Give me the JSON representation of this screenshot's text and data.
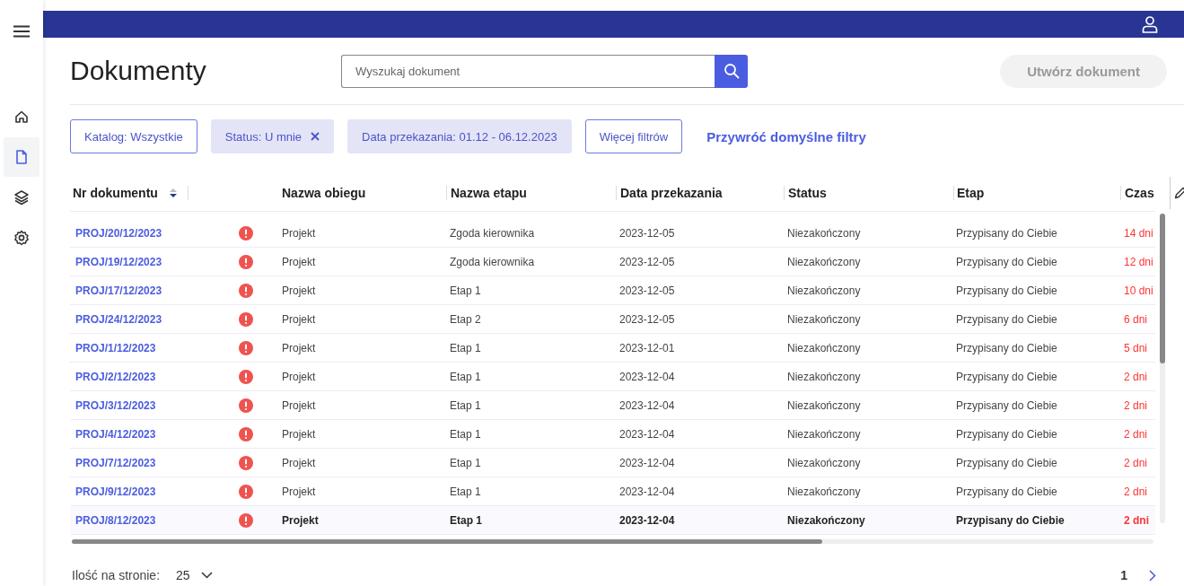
{
  "sidebar": {
    "items": [
      {
        "kind": "home",
        "selected": false
      },
      {
        "kind": "document",
        "selected": true
      },
      {
        "kind": "layers",
        "selected": false
      },
      {
        "kind": "settings",
        "selected": false
      }
    ]
  },
  "header": {
    "title": "Dokumenty",
    "search": {
      "placeholder": "Wyszukaj dokument"
    },
    "create_button": {
      "label": "Utwórz dokument",
      "disabled": true
    }
  },
  "filters": [
    {
      "kind": "outline",
      "label": "Katalog: Wszystkie",
      "removable": false
    },
    {
      "kind": "chip",
      "label": "Status: U mnie",
      "removable": true
    },
    {
      "kind": "chip",
      "label": "Data przekazania: 01.12 - 06.12.2023",
      "removable": false
    },
    {
      "kind": "outline",
      "label": "Więcej filtrów",
      "removable": false
    }
  ],
  "reset_link": "Przywróć domyślne filtry",
  "table": {
    "columns": [
      {
        "label": "Nr dokumentu",
        "sortable": true
      },
      {
        "label": "Nazwa obiegu"
      },
      {
        "label": "Nazwa etapu"
      },
      {
        "label": "Data przekazania"
      },
      {
        "label": "Status"
      },
      {
        "label": "Etap"
      },
      {
        "label": "Czas"
      }
    ],
    "rows": [
      {
        "number": "PROJ/20/12/2023",
        "alert": true,
        "workflow": "Projekt",
        "stage": "Zgoda kierownika",
        "date": "2023-12-05",
        "status": "Niezakończony",
        "step": "Przypisany do Ciebie",
        "time": "14 dni",
        "selected": false
      },
      {
        "number": "PROJ/19/12/2023",
        "alert": true,
        "workflow": "Projekt",
        "stage": "Zgoda kierownika",
        "date": "2023-12-05",
        "status": "Niezakończony",
        "step": "Przypisany do Ciebie",
        "time": "12 dni",
        "selected": false
      },
      {
        "number": "PROJ/17/12/2023",
        "alert": true,
        "workflow": "Projekt",
        "stage": "Etap 1",
        "date": "2023-12-05",
        "status": "Niezakończony",
        "step": "Przypisany do Ciebie",
        "time": "10 dni",
        "selected": false
      },
      {
        "number": "PROJ/24/12/2023",
        "alert": true,
        "workflow": "Projekt",
        "stage": "Etap 2",
        "date": "2023-12-05",
        "status": "Niezakończony",
        "step": "Przypisany do Ciebie",
        "time": "6 dni",
        "selected": false
      },
      {
        "number": "PROJ/1/12/2023",
        "alert": true,
        "workflow": "Projekt",
        "stage": "Etap 1",
        "date": "2023-12-01",
        "status": "Niezakończony",
        "step": "Przypisany do Ciebie",
        "time": "5 dni",
        "selected": false
      },
      {
        "number": "PROJ/2/12/2023",
        "alert": true,
        "workflow": "Projekt",
        "stage": "Etap 1",
        "date": "2023-12-04",
        "status": "Niezakończony",
        "step": "Przypisany do Ciebie",
        "time": "2 dni",
        "selected": false
      },
      {
        "number": "PROJ/3/12/2023",
        "alert": true,
        "workflow": "Projekt",
        "stage": "Etap 1",
        "date": "2023-12-04",
        "status": "Niezakończony",
        "step": "Przypisany do Ciebie",
        "time": "2 dni",
        "selected": false
      },
      {
        "number": "PROJ/4/12/2023",
        "alert": true,
        "workflow": "Projekt",
        "stage": "Etap 1",
        "date": "2023-12-04",
        "status": "Niezakończony",
        "step": "Przypisany do Ciebie",
        "time": "2 dni",
        "selected": false
      },
      {
        "number": "PROJ/7/12/2023",
        "alert": true,
        "workflow": "Projekt",
        "stage": "Etap 1",
        "date": "2023-12-04",
        "status": "Niezakończony",
        "step": "Przypisany do Ciebie",
        "time": "2 dni",
        "selected": false
      },
      {
        "number": "PROJ/9/12/2023",
        "alert": true,
        "workflow": "Projekt",
        "stage": "Etap 1",
        "date": "2023-12-04",
        "status": "Niezakończony",
        "step": "Przypisany do Ciebie",
        "time": "2 dni",
        "selected": false
      },
      {
        "number": "PROJ/8/12/2023",
        "alert": true,
        "workflow": "Projekt",
        "stage": "Etap 1",
        "date": "2023-12-04",
        "status": "Niezakończony",
        "step": "Przypisany do Ciebie",
        "time": "2 dni",
        "selected": true
      }
    ]
  },
  "pagination": {
    "page_size_label": "Ilość na stronie:",
    "page_size": "25",
    "pages": [
      {
        "label": "1",
        "selected": true
      }
    ]
  }
}
